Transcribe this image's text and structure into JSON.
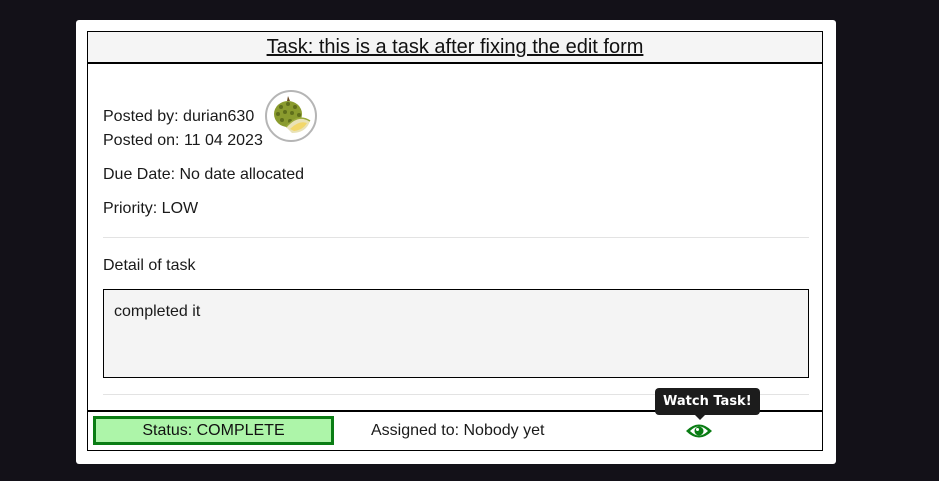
{
  "task": {
    "title": "Task: this is a task after fixing the edit form",
    "posted_by": "Posted by: durian630",
    "posted_on": "Posted on: 11 04 2023",
    "due_date": "Due Date: No date allocated",
    "priority": "Priority: LOW",
    "detail_label": "Detail of task",
    "detail_text": "completed it"
  },
  "footer": {
    "status": "Status: COMPLETE",
    "assigned_to": "Assigned to: Nobody yet",
    "watch_tooltip": "Watch Task!"
  },
  "colors": {
    "status_fill": "#adf5a9",
    "status_border": "#0a7d14",
    "eye_icon": "#0a7d14"
  },
  "icons": {
    "avatar": "durian-avatar",
    "watch": "eye-icon"
  }
}
